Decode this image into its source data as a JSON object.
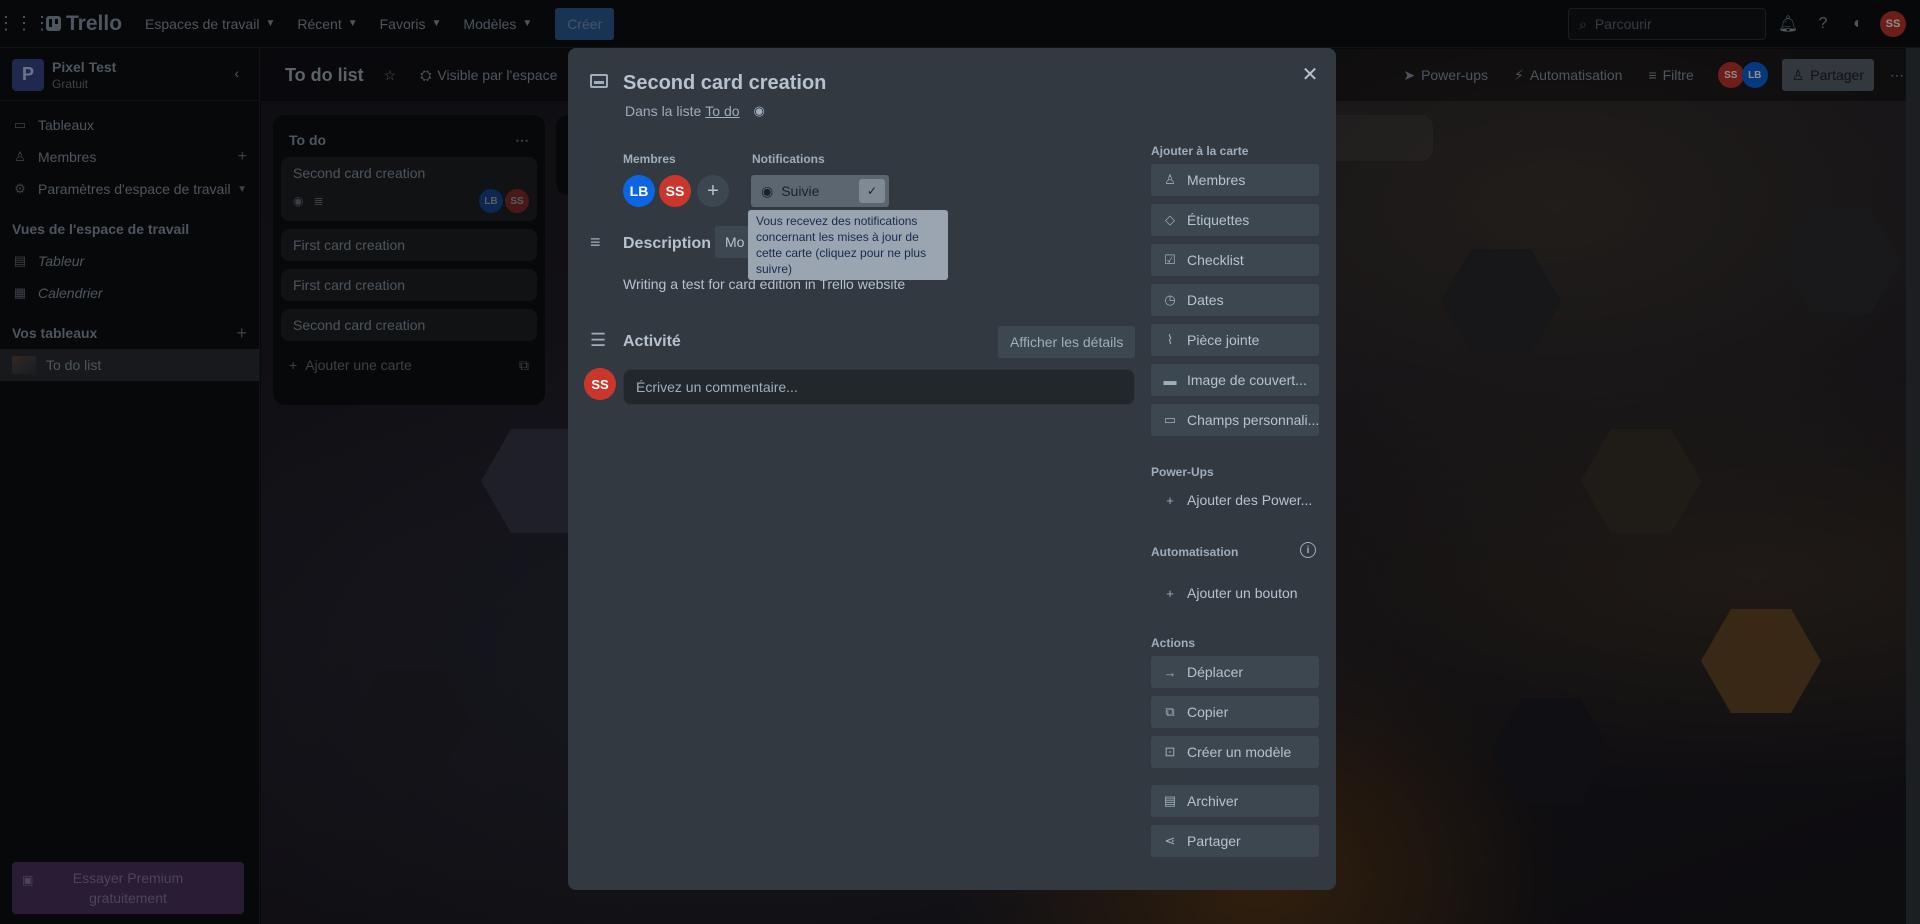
{
  "topbar": {
    "brand": "Trello",
    "nav": [
      {
        "label": "Espaces de travail"
      },
      {
        "label": "Récent"
      },
      {
        "label": "Favoris"
      },
      {
        "label": "Modèles"
      }
    ],
    "create_label": "Créer",
    "search_placeholder": "Parcourir",
    "user_initials": "SS"
  },
  "sidebar": {
    "workspace_initial": "P",
    "workspace_name": "Pixel Test",
    "workspace_plan": "Gratuit",
    "items": [
      {
        "label": "Tableaux"
      },
      {
        "label": "Membres"
      },
      {
        "label": "Paramètres d'espace de travail"
      }
    ],
    "views_title": "Vues de l'espace de travail",
    "views": [
      {
        "label": "Tableur"
      },
      {
        "label": "Calendrier"
      }
    ],
    "boards_title": "Vos tableaux",
    "boards": [
      {
        "label": "To do list"
      }
    ],
    "premium_label": "Essayer Premium gratuitement"
  },
  "board": {
    "title": "To do list",
    "visibility": "Visible par l'espace",
    "powerups": "Power-ups",
    "automation": "Automatisation",
    "filter": "Filtre",
    "share": "Partager",
    "member_initials": [
      "SS",
      "LB"
    ],
    "list": {
      "title": "To do",
      "cards": [
        {
          "title": "Second card creation"
        },
        {
          "title": "First card creation"
        },
        {
          "title": "First card creation"
        },
        {
          "title": "Second card creation"
        }
      ],
      "card_members": [
        "LB",
        "SS"
      ],
      "add_card": "Ajouter une carte"
    }
  },
  "modal": {
    "title": "Second card creation",
    "in_list_prefix": "Dans la liste",
    "in_list_name": "To do",
    "members_label": "Membres",
    "members": [
      "LB",
      "SS"
    ],
    "notifications_label": "Notifications",
    "watch_label": "Suivie",
    "tooltip": "Vous recevez des notifications concernant les mises à jour de cette carte (cliquez pour ne plus suivre)",
    "description_title": "Description",
    "modify_label": "Mo",
    "description_text": "Writing a test for card edition in Trello website",
    "activity_title": "Activité",
    "show_details": "Afficher les détails",
    "comment_avatar": "SS",
    "comment_placeholder": "Écrivez un commentaire...",
    "add_to_card_label": "Ajouter à la carte",
    "add_to_card": [
      {
        "label": "Membres"
      },
      {
        "label": "Étiquettes"
      },
      {
        "label": "Checklist"
      },
      {
        "label": "Dates"
      },
      {
        "label": "Pièce jointe"
      },
      {
        "label": "Image de couvert..."
      },
      {
        "label": "Champs personnali..."
      }
    ],
    "powerups_label": "Power-Ups",
    "add_powerups": "Ajouter des Power...",
    "automation_label": "Automatisation",
    "add_button": "Ajouter un bouton",
    "actions_label": "Actions",
    "actions": [
      {
        "label": "Déplacer"
      },
      {
        "label": "Copier"
      },
      {
        "label": "Créer un modèle"
      }
    ],
    "archive": "Archiver",
    "share": "Partager"
  },
  "colors": {
    "modal_bg": "#323940",
    "avatar_ss": "#c9372c",
    "avatar_lb": "#0c66e4",
    "create_button": "#2f5e9a"
  }
}
